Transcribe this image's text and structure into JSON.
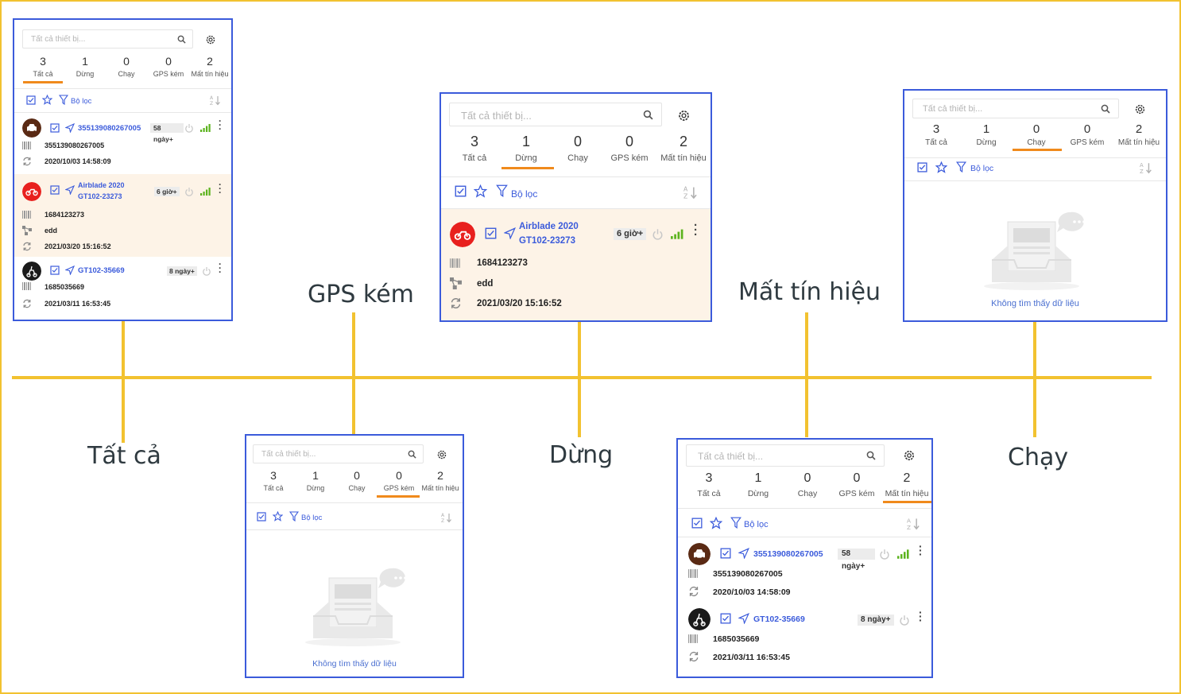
{
  "labels": {
    "all": "Tất cả",
    "gps_weak": "GPS kém",
    "stopped": "Dừng",
    "lost_signal": "Mất tín hiệu",
    "running": "Chạy"
  },
  "panel": {
    "search_placeholder": "Tất cả thiết bị...",
    "stats": [
      {
        "count": "3",
        "label": "Tất cả"
      },
      {
        "count": "1",
        "label": "Dừng"
      },
      {
        "count": "0",
        "label": "Chạy"
      },
      {
        "count": "0",
        "label": "GPS kém"
      },
      {
        "count": "2",
        "label": "Mất tín hiệu"
      }
    ],
    "filter_label": "Bộ lọc",
    "sort_icon": "sort-az-icon",
    "empty_text": "Không tìm thấy dữ liệu"
  },
  "devices": {
    "d1": {
      "id": "355139080267005",
      "badge": "58",
      "badge_sub": "ngày+",
      "imei": "355139080267005",
      "time": "2020/10/03 14:58:09"
    },
    "d2": {
      "name": "Airblade 2020",
      "plate": "GT102-23273",
      "badge": "6 giờ+",
      "imei": "1684123273",
      "group": "edd",
      "time": "2021/03/20 15:16:52"
    },
    "d3": {
      "id": "GT102-35669",
      "badge": "8 ngày+",
      "imei": "1685035669",
      "time": "2021/03/11 16:53:45"
    }
  },
  "colors": {
    "border_accent": "#3b5bdb",
    "timeline": "#f2c230",
    "active_tab": "#f08a1c",
    "selected_row": "#fdf3e7",
    "signal_green": "#5cb31e"
  }
}
